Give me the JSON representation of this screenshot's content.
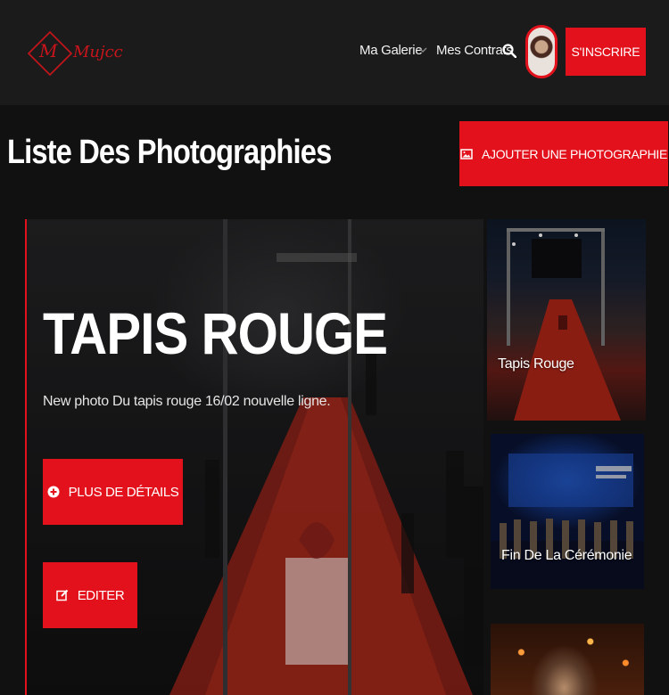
{
  "header": {
    "nav": [
      {
        "label": "Ma Galerie",
        "icon": "chevron-down-icon"
      },
      {
        "label": "Mes Contrats"
      }
    ],
    "search_icon": "search-icon",
    "signup_label": "S'INSCRIRE"
  },
  "page": {
    "title": "Liste Des Photographies",
    "add_button": "AJOUTER UNE PHOTOGRAPHIE"
  },
  "featured": {
    "title": "TAPIS ROUGE",
    "description": "New photo Du tapis rouge 16/02 nouvelle ligne.",
    "details_button": "PLUS DE DÉTAILS",
    "edit_button": "EDITER"
  },
  "thumbnails": [
    {
      "label": "Tapis Rouge"
    },
    {
      "label": "Fin De La Cérémonie"
    },
    {
      "label": ""
    }
  ],
  "colors": {
    "accent": "#e3111b",
    "header_bg": "#1b1b1b",
    "page_bg": "#111111"
  }
}
